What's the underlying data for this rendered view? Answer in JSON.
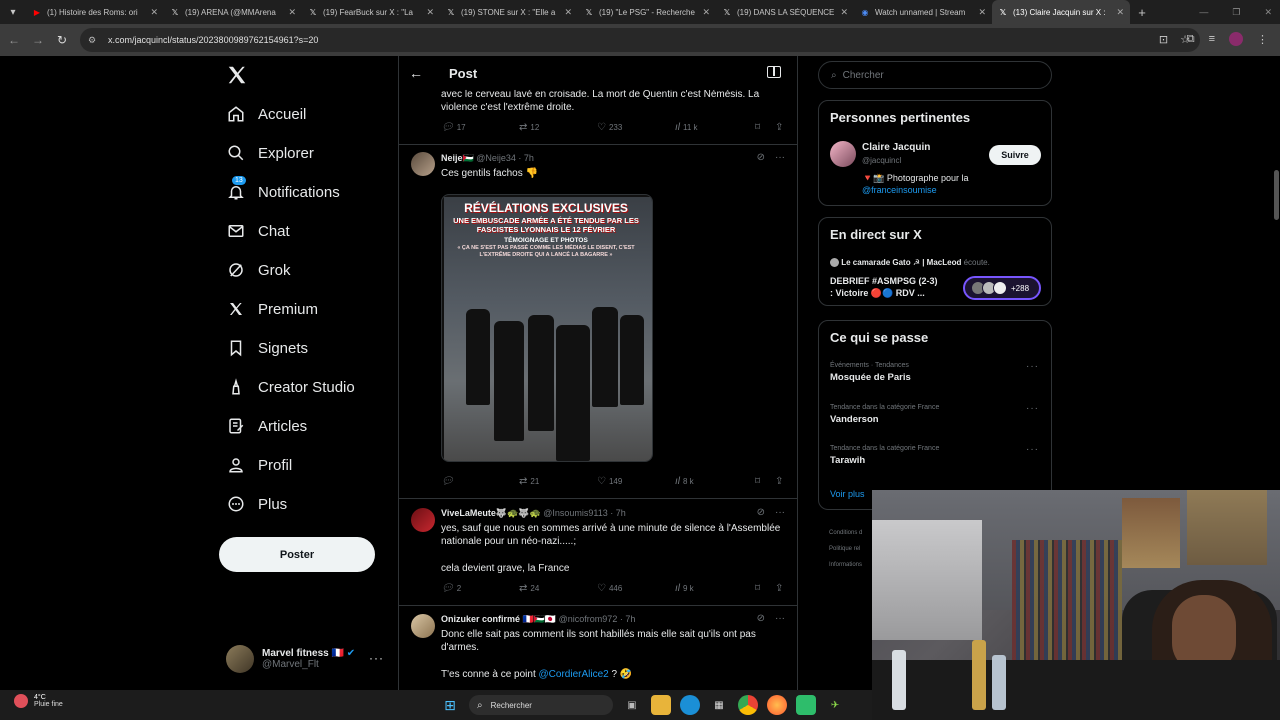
{
  "browser": {
    "tabs": [
      {
        "title": "(1) Histoire des Roms: ori",
        "icon": "youtube-icon",
        "color": "#ff0000"
      },
      {
        "title": "(19) ARENA (@MMArena",
        "icon": "x-icon",
        "color": "#ffffff"
      },
      {
        "title": "(19) FearBuck sur X : \"La",
        "icon": "x-icon",
        "color": "#ffffff"
      },
      {
        "title": "(19) STONE sur X : \"Elle a",
        "icon": "x-icon",
        "color": "#ffffff"
      },
      {
        "title": "(19) \"Le PSG\" - Recherche",
        "icon": "x-icon",
        "color": "#ffffff"
      },
      {
        "title": "(19) DANS LA SÉQUENCE",
        "icon": "x-icon",
        "color": "#ffffff"
      },
      {
        "title": "Watch unnamed | Stream",
        "icon": "stream-icon",
        "color": "#4c8bf5"
      },
      {
        "title": "(13) Claire Jacquin sur X :",
        "icon": "x-icon",
        "color": "#ffffff",
        "active": true
      }
    ],
    "url": "x.com/jacquincl/status/2023800989762154961?s=20"
  },
  "nav": {
    "items": [
      {
        "label": "Accueil",
        "icon": "home-icon"
      },
      {
        "label": "Explorer",
        "icon": "search-icon"
      },
      {
        "label": "Notifications",
        "icon": "bell-icon",
        "badge": "13"
      },
      {
        "label": "Chat",
        "icon": "mail-icon"
      },
      {
        "label": "Grok",
        "icon": "grok-icon"
      },
      {
        "label": "Premium",
        "icon": "x-logo-icon"
      },
      {
        "label": "Signets",
        "icon": "bookmark-icon"
      },
      {
        "label": "Creator Studio",
        "icon": "creator-icon"
      },
      {
        "label": "Articles",
        "icon": "articles-icon"
      },
      {
        "label": "Profil",
        "icon": "person-icon"
      },
      {
        "label": "Plus",
        "icon": "more-circle-icon"
      }
    ],
    "post_button": "Poster",
    "account": {
      "name": "Marvel fitness 🇫🇷",
      "handle": "@Marvel_Flt"
    }
  },
  "header": {
    "title": "Post"
  },
  "feed": {
    "top_tweet": {
      "text_line1": "avec le cerveau lavé en croisade. La mort de Quentin c'est Némésis. La",
      "text_line2": "violence c'est l'extrême droite.",
      "replies": "17",
      "reposts": "12",
      "likes": "233",
      "views": "11 k"
    },
    "tweet1": {
      "name": "Neije🇵🇸",
      "handle": "@Neije34",
      "time": "· 7h",
      "text": "Ces gentils fachos 👎",
      "media": {
        "caption1": "RÉVÉLATIONS EXCLUSIVES",
        "caption2": "UNE EMBUSCADE ARMÉE A ÉTÉ TENDUE PAR LES FASCISTES LYONNAIS LE 12 FÉVRIER",
        "caption3": "TÉMOIGNAGE ET PHOTOS",
        "caption4": "« ÇA NE S'EST PAS PASSÉ COMME LES MÉDIAS LE DISENT, C'EST L'EXTRÊME DROITE QUI A LANCÉ LA BAGARRE »"
      },
      "replies": "",
      "reposts": "21",
      "likes": "149",
      "views": "8 k"
    },
    "tweet2": {
      "name": "ViveLaMeute🐺🐢🐺🐢",
      "handle": "@Insoumis9113",
      "time": "· 7h",
      "text1": "yes, sauf que nous en sommes arrivé à une minute de silence à l'Assemblée",
      "text2": "nationale pour un néo-nazi.....;",
      "text3": "cela devient grave, la France",
      "replies": "2",
      "reposts": "24",
      "likes": "446",
      "views": "9 k"
    },
    "tweet3": {
      "name": "Onizuker confirmé 🇫🇷🇵🇸🇯🇵",
      "handle": "@nicofrom972",
      "time": "· 7h",
      "text1": "Donc elle sait pas comment ils sont habillés mais elle sait qu'ils ont pas",
      "text2": "d'armes.",
      "text3_pre": "T'es conne à ce point ",
      "text3_mention": "@CordierAlice2",
      "text3_post": " ? 🤣"
    }
  },
  "sidebar": {
    "search_placeholder": "Chercher",
    "relevant": {
      "title": "Personnes pertinentes",
      "name": "Claire Jacquin",
      "handle": "@jacquincl",
      "bio_pre": "🔻📸 Photographe pour la",
      "bio_link": "@franceinsoumise",
      "follow": "Suivre"
    },
    "live": {
      "title": "En direct sur X",
      "host": "Le camarade Gato ☭ | MacLeod",
      "host_suffix": "écoute.",
      "line1": "DEBRIEF #ASMPSG (2-3)",
      "line2": ": Victoire 🔴🔵 RDV ...",
      "count": "+288"
    },
    "trends": {
      "title": "Ce qui se passe",
      "items": [
        {
          "category": "Événements · Tendances",
          "name": "Mosquée de Paris"
        },
        {
          "category": "Tendance dans la catégorie France",
          "name": "Vanderson"
        },
        {
          "category": "Tendance dans la catégorie France",
          "name": "Tarawih"
        }
      ],
      "more": "Voir plus"
    },
    "footer": [
      "Conditions d",
      "Politique rel",
      "Informations"
    ]
  },
  "taskbar": {
    "temp": "4°C",
    "weather": "Pluie fine",
    "search": "Rechercher"
  }
}
